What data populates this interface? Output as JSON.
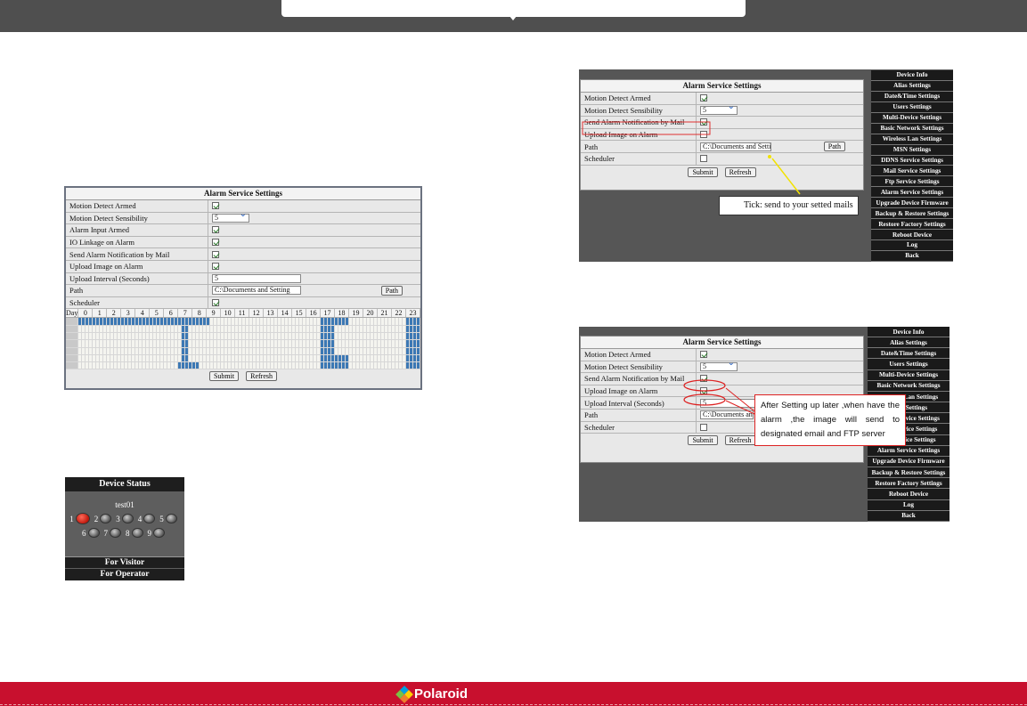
{
  "alarm_settings_title": "Alarm Service Settings",
  "panel_main": {
    "rows": [
      {
        "label": "Motion Detect Armed",
        "type": "check",
        "checked": true
      },
      {
        "label": "Motion Detect Sensibility",
        "type": "select",
        "value": "5"
      },
      {
        "label": "Alarm Input Armed",
        "type": "check",
        "checked": true
      },
      {
        "label": "IO Linkage on Alarm",
        "type": "check",
        "checked": true
      },
      {
        "label": "Send Alarm Notification by Mail",
        "type": "check",
        "checked": true
      },
      {
        "label": "Upload Image on Alarm",
        "type": "check",
        "checked": true
      },
      {
        "label": "Upload Interval (Seconds)",
        "type": "text",
        "value": "5"
      },
      {
        "label": "Path",
        "type": "path",
        "value": "C:\\Documents and Setting"
      },
      {
        "label": "Scheduler",
        "type": "check",
        "checked": true
      }
    ],
    "schedule": {
      "day_label": "Day",
      "hours": [
        "0",
        "1",
        "2",
        "3",
        "4",
        "5",
        "6",
        "7",
        "8",
        "9",
        "10",
        "11",
        "12",
        "13",
        "14",
        "15",
        "16",
        "17",
        "18",
        "19",
        "20",
        "21",
        "22",
        "23"
      ],
      "days": [
        "Sun",
        "Mon",
        "Tue",
        "Wed",
        "Thu",
        "Fri",
        "Sat"
      ]
    }
  },
  "panel_top_right": {
    "rows": [
      {
        "label": "Motion Detect Armed",
        "type": "check",
        "checked": true
      },
      {
        "label": "Motion Detect Sensibility",
        "type": "select",
        "value": "5"
      },
      {
        "label": "Send Alarm Notification by Mail",
        "type": "check",
        "checked": true
      },
      {
        "label": "Upload Image on Alarm",
        "type": "check",
        "checked": false
      },
      {
        "label": "Path",
        "type": "path",
        "value": "C:\\Documents and Setting"
      },
      {
        "label": "Scheduler",
        "type": "check",
        "checked": false
      }
    ],
    "callout": "Tick: send to your setted mails"
  },
  "panel_bottom_right": {
    "rows": [
      {
        "label": "Motion Detect Armed",
        "type": "check",
        "checked": true
      },
      {
        "label": "Motion Detect Sensibility",
        "type": "select",
        "value": "5"
      },
      {
        "label": "Send Alarm Notification by Mail",
        "type": "check",
        "checked": true
      },
      {
        "label": "Upload Image on Alarm",
        "type": "check",
        "checked": true
      },
      {
        "label": "Upload Interval (Seconds)",
        "type": "text",
        "value": "5"
      },
      {
        "label": "Path",
        "type": "path",
        "value": "C:\\Documents and S"
      },
      {
        "label": "Scheduler",
        "type": "check",
        "checked": false
      }
    ],
    "callout": "After Setting up later ,when have the alarm ,the image will send to designated email and FTP server"
  },
  "buttons": {
    "submit": "Submit",
    "refresh": "Refresh",
    "path": "Path"
  },
  "menu_items": [
    "Device Info",
    "Alias Settings",
    "Date&Time Settings",
    "Users Settings",
    "Multi-Device Settings",
    "Basic Network Settings",
    "Wireless Lan Settings",
    "MSN Settings",
    "DDNS Service Settings",
    "Mail Service Settings",
    "Ftp Service Settings",
    "Alarm Service Settings",
    "Upgrade Device Firmware",
    "Backup & Restore Settings",
    "Restore Factory Settings",
    "Reboot Device",
    "Log",
    "Back"
  ],
  "device_status": {
    "title": "Device Status",
    "device_name": "test01",
    "slots": [
      "1",
      "2",
      "3",
      "4",
      "5",
      "6",
      "7",
      "8",
      "9"
    ],
    "for_visitor": "For Visitor",
    "for_operator": "For Operator"
  },
  "brand": "Polaroid",
  "colors": {
    "footer": "#c8102e",
    "schedule_on": "#3c78b4",
    "menu_bg": "#1a1a1a"
  }
}
